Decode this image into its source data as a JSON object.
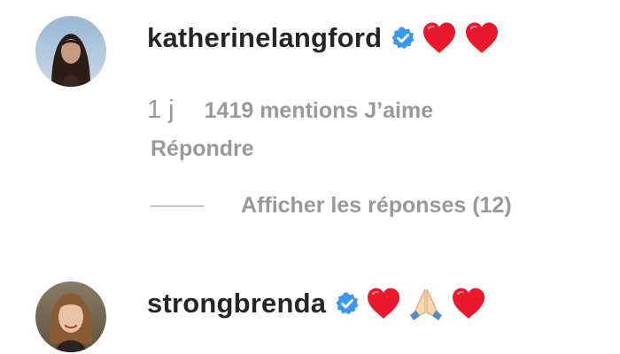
{
  "comments": [
    {
      "username": "katherinelangford",
      "time": "1 j",
      "likes": "1419 mentions J’aime",
      "reply": "Répondre",
      "show_replies": "Afficher les réponses (12)"
    },
    {
      "username": "strongbrenda"
    }
  ],
  "icons": {
    "verified": "verified-badge-icon",
    "heart": "red-heart-emoji",
    "pray": "folded-hands-emoji"
  },
  "colors": {
    "username": "#262626",
    "secondary": "#999999",
    "verified": "#3897f0",
    "heart": "#e8192c",
    "divider": "#c7c7c7"
  }
}
